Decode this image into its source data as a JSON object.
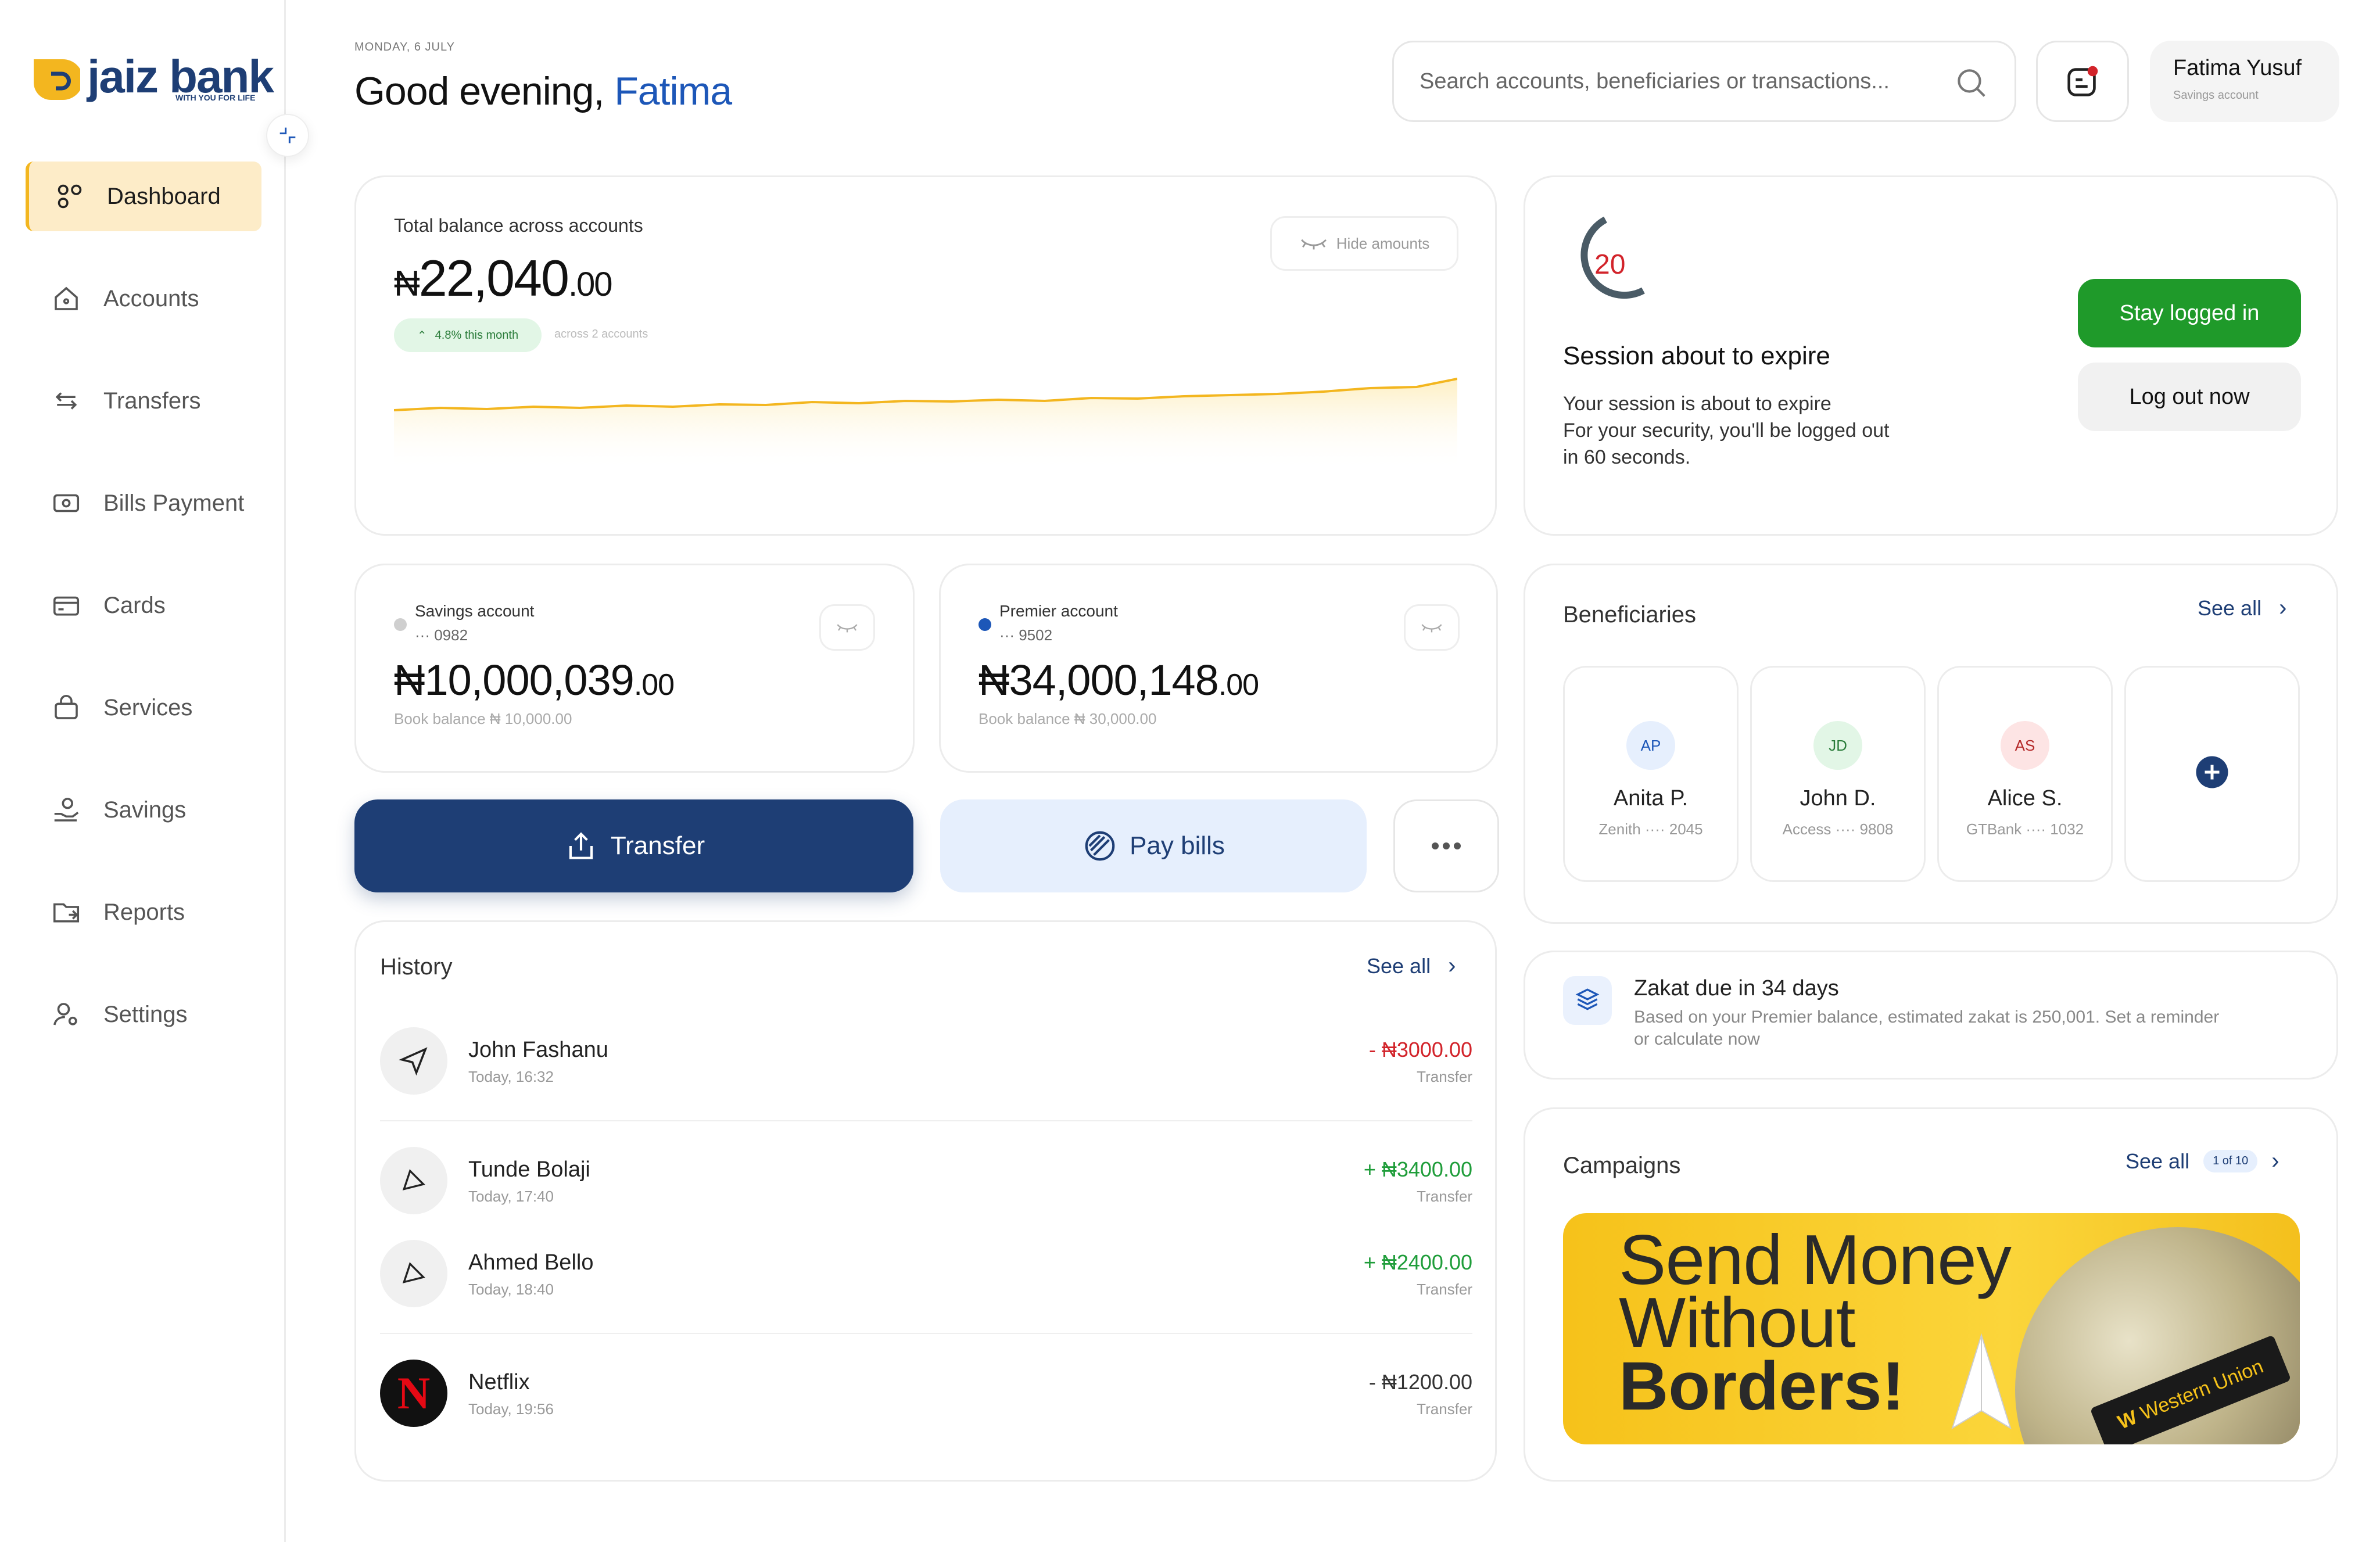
{
  "brand": {
    "name": "jaiz bank",
    "tagline": "WITH YOU FOR LIFE",
    "accent": "#f3b61f",
    "primary": "#1e3e75"
  },
  "sidebar": {
    "items": [
      {
        "label": "Dashboard",
        "icon": "dashboard-icon",
        "active": true
      },
      {
        "label": "Accounts",
        "icon": "home-icon"
      },
      {
        "label": "Transfers",
        "icon": "transfer-arrows-icon"
      },
      {
        "label": "Bills Payment",
        "icon": "bill-icon"
      },
      {
        "label": "Cards",
        "icon": "card-icon"
      },
      {
        "label": "Services",
        "icon": "bag-icon"
      },
      {
        "label": "Savings",
        "icon": "savings-hand-icon"
      },
      {
        "label": "Reports",
        "icon": "folder-icon"
      },
      {
        "label": "Settings",
        "icon": "user-settings-icon"
      }
    ]
  },
  "header": {
    "date": "MONDAY, 6 JULY",
    "greeting": "Good evening,",
    "user_first": "Fatima",
    "search_placeholder": "Search accounts, beneficiaries or transactions...",
    "user_name": "Fatima Yusuf",
    "user_type": "Savings account"
  },
  "balance": {
    "label": "Total balance across accounts",
    "currency": "₦",
    "whole": "22,040",
    "decimal": ".00",
    "change": "4.8% this month",
    "note": "across 2 accounts",
    "hide_label": "Hide amounts"
  },
  "accounts": [
    {
      "name": "Savings account",
      "number": "··· 0982",
      "whole": "₦10,000,039",
      "decimal": ".00",
      "book": "Book balance  ₦ 10,000.00",
      "dot": "#cfcfcf"
    },
    {
      "name": "Premier account",
      "number": "··· 9502",
      "whole": "₦34,000,148",
      "decimal": ".00",
      "book": "Book balance  ₦ 30,000.00",
      "dot": "#1d57b8"
    }
  ],
  "actions": {
    "transfer": "Transfer",
    "pay_bills": "Pay bills"
  },
  "history": {
    "title": "History",
    "see_all": "See all",
    "rows": [
      {
        "name": "John Fashanu",
        "time": "Today, 16:32",
        "amount": "- ₦3000.00",
        "type": "Transfer",
        "color": "red"
      },
      {
        "name": "Tunde Bolaji",
        "time": "Today, 17:40",
        "amount": "+ ₦3400.00",
        "type": "Transfer",
        "color": "green"
      },
      {
        "name": "Ahmed Bello",
        "time": "Today, 18:40",
        "amount": "+ ₦2400.00",
        "type": "Transfer",
        "color": "green"
      },
      {
        "name": "Netflix",
        "time": "Today, 19:56",
        "amount": "- ₦1200.00",
        "type": "Transfer",
        "color": "dark"
      }
    ]
  },
  "session": {
    "countdown": "20",
    "title": "Session about to expire",
    "line1": "Your session is about to expire",
    "line2": "For your security, you'll be logged out",
    "line3": "in 60 seconds.",
    "stay": "Stay logged in",
    "logout": "Log out now"
  },
  "beneficiaries": {
    "title": "Beneficiaries",
    "see_all": "See all",
    "items": [
      {
        "initials": "AP",
        "name": "Anita P.",
        "bank": "Zenith ···· 2045",
        "bg": "#e6effd",
        "fg": "#1d57b8"
      },
      {
        "initials": "JD",
        "name": "John D.",
        "bank": "Access ···· 9808",
        "bg": "#e2f6e6",
        "fg": "#2a7c3a"
      },
      {
        "initials": "AS",
        "name": "Alice S.",
        "bank": "GTBank ···· 1032",
        "bg": "#fde4e4",
        "fg": "#b52a2a"
      }
    ]
  },
  "zakat": {
    "title": "Zakat due in 34 days",
    "desc1": "Based on your Premier balance, estimated zakat is 250,001. Set a reminder",
    "desc2": "or calculate now"
  },
  "campaigns": {
    "title": "Campaigns",
    "see_all": "See all",
    "pager": "1 of 10",
    "line1": "Send Money",
    "line2": "Without",
    "line3": "Borders!",
    "partner": "Western Union"
  }
}
